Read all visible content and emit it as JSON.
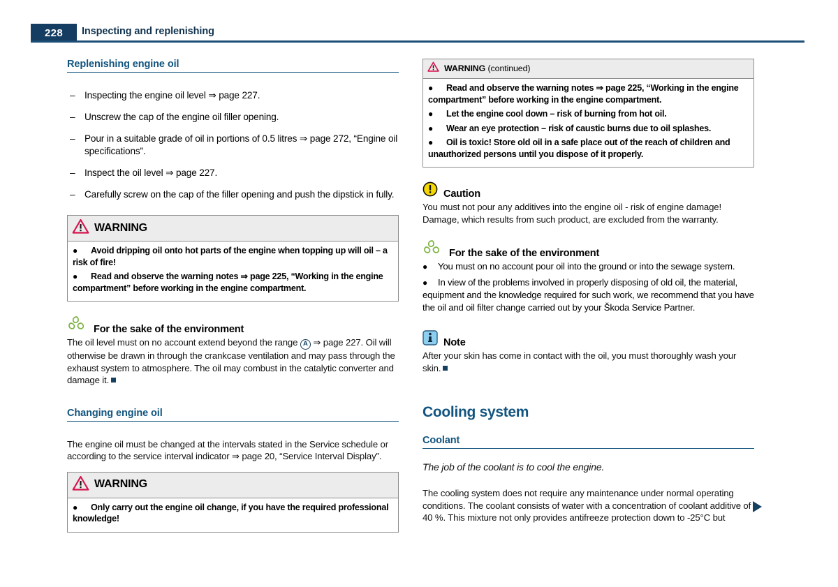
{
  "header": {
    "page_number": "228",
    "title": "Inspecting and replenishing"
  },
  "left_column": {
    "heading_1": "Replenishing engine oil",
    "steps": [
      "Inspecting the engine oil level ⇒ page 227.",
      "Unscrew the cap of the engine oil filler opening.",
      "Pour in a suitable grade of oil in portions of 0.5 litres ⇒ page 272, “Engine oil specifications”.",
      "Inspect the oil level ⇒ page 227.",
      "Carefully screw on the cap of the filler opening and push the dipstick in fully."
    ],
    "warning_1": {
      "title": "WARNING",
      "icon": "warning-triangle-icon",
      "bullets": [
        "Avoid dripping oil onto hot parts of the engine when topping up will oil – a risk of fire!",
        "Read and observe the warning notes ⇒ page 225, “Working in the engine compartment” before working in the engine compartment."
      ]
    },
    "environment": {
      "icon": "recycling-icon",
      "title": "For the sake of the environment",
      "text_part_1": "The oil level must on no account extend beyond the range ",
      "marker_letter": "A",
      "text_part_2": " ⇒ page 227. Oil will otherwise be drawn in through the crankcase ventilation and may pass through the exhaust system to atmosphere. The oil may combust in the catalytic converter and damage it."
    },
    "heading_2": "Changing engine oil",
    "paragraph_2": "The engine oil must be changed at the intervals stated in the Service schedule or according to the service interval indicator ⇒ page 20, “Service Interval Display”.",
    "warning_2": {
      "title": "WARNING",
      "icon": "warning-triangle-icon",
      "bullets": [
        "Only carry out the engine oil change, if you have the required professional knowledge!"
      ]
    }
  },
  "right_column": {
    "warning_continued": {
      "title": "WARNING",
      "title_suffix": " (continued)",
      "icon": "warning-triangle-icon",
      "bullets": [
        "Read and observe the warning notes ⇒ page 225, “Working in the engine compartment” before working in the engine compartment.",
        "Let the engine cool down – risk of burning from hot oil.",
        "Wear an eye protection – risk of caustic burns due to oil splashes.",
        "Oil is toxic! Store old oil in a safe place out of the reach of children and unauthorized persons until you dispose of it properly."
      ]
    },
    "caution": {
      "icon": "caution-circle-icon",
      "title": "Caution",
      "text": "You must not pour any additives into the engine oil - risk of engine damage! Damage, which results from such product, are excluded from the warranty."
    },
    "environment": {
      "icon": "recycling-icon",
      "title": "For the sake of the environment",
      "bullets": [
        "You must on no account pour oil into the ground or into the sewage system.",
        "In view of the problems involved in properly disposing of old oil, the material, equipment and the knowledge required for such work, we recommend that you have the oil and oil filter change carried out by your Škoda Service Partner."
      ]
    },
    "note": {
      "icon": "info-note-icon",
      "title": "Note",
      "text": "After your skin has come in contact with the oil, you must thoroughly wash your skin."
    },
    "chapter_heading": "Cooling system",
    "heading_coolant": "Coolant",
    "coolant_intro": "The job of the coolant is to cool the engine.",
    "coolant_paragraph": "The cooling system does not require any maintenance under normal operating conditions. The coolant consists of water with a concentration of coolant additive of 40 %. This mixture not only provides antifreeze protection down to -25°C but",
    "continue_arrow": "continue-arrow-icon"
  },
  "colors": {
    "navy": "#153d62",
    "heading_blue": "#11547f",
    "warning_red": "#d6144e",
    "caution_yellow": "#f5d800",
    "note_blue": "#8ecff0",
    "env_green": "#7cb342"
  }
}
